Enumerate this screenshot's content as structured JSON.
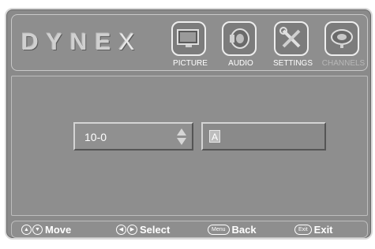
{
  "brand": {
    "logo_text": "DYNE",
    "logo_x": "X"
  },
  "tabs": [
    {
      "label": "PICTURE",
      "icon": "tv-icon"
    },
    {
      "label": "AUDIO",
      "icon": "speaker-icon"
    },
    {
      "label": "SETTINGS",
      "icon": "tools-icon"
    },
    {
      "label": "CHANNELS",
      "icon": "satellite-dish-icon"
    }
  ],
  "main": {
    "channel_value": "10-0",
    "name_char": "A"
  },
  "footer": {
    "move_label": "Move",
    "select_label": "Select",
    "back_key": "Menu",
    "back_label": "Back",
    "exit_key": "Exit",
    "exit_label": "Exit"
  }
}
